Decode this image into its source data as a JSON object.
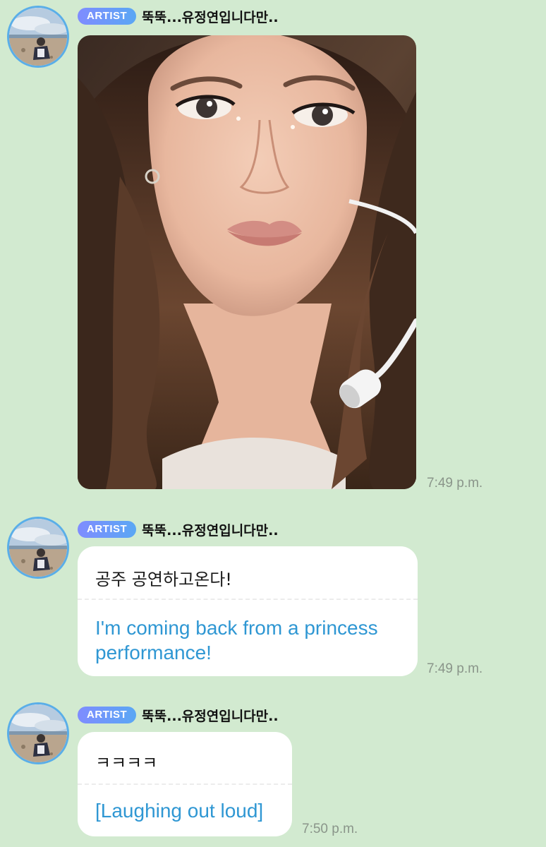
{
  "messages": [
    {
      "badge": "ARTIST",
      "sender": "뚝뚝...유정연입니다만..",
      "type": "photo",
      "time": "7:49 p.m."
    },
    {
      "badge": "ARTIST",
      "sender": "뚝뚝...유정연입니다만..",
      "type": "text",
      "original": "공주 공연하고온다!",
      "translation": "I'm coming back from a princess performance!",
      "time": "7:49 p.m."
    },
    {
      "badge": "ARTIST",
      "sender": "뚝뚝...유정연입니다만..",
      "type": "text",
      "original": "ㅋㅋㅋㅋ",
      "translation": "[Laughing out loud]",
      "time": "7:50 p.m."
    }
  ],
  "colors": {
    "background": "#d2ead0",
    "badge_start": "#7f8cff",
    "badge_end": "#5aa7f4",
    "avatar_ring": "#5aaee8",
    "translation_text": "#2f97d3",
    "timestamp": "#8a958a"
  },
  "icons": {
    "avatar": "profile-photo-beach",
    "badge": "artist-badge"
  }
}
